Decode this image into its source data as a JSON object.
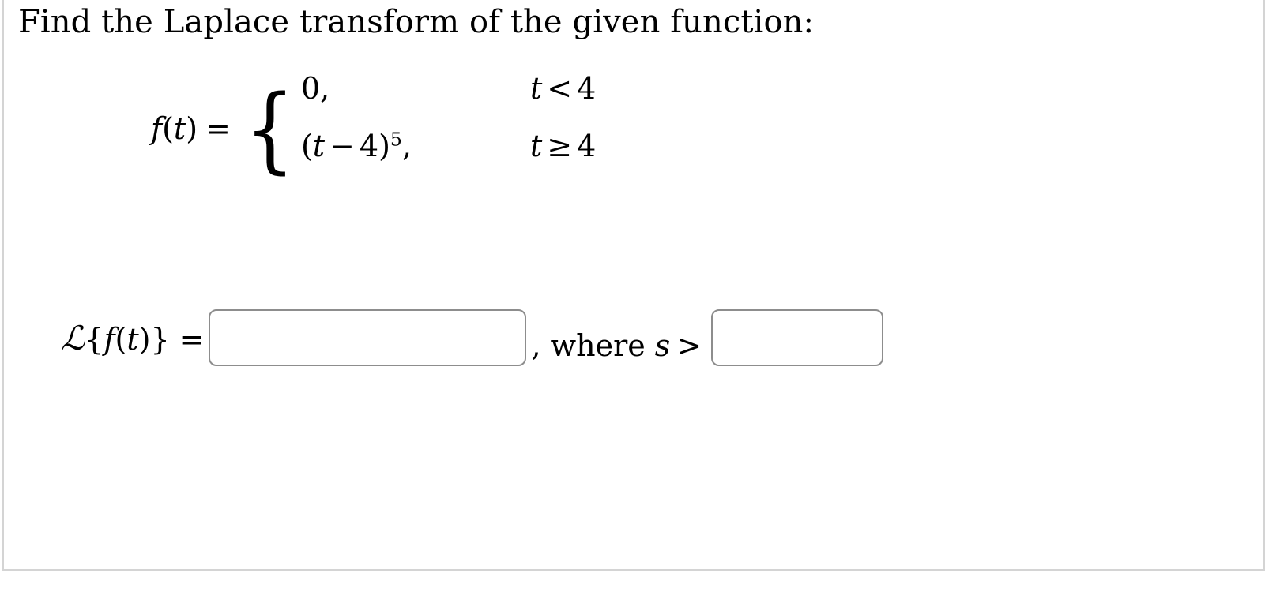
{
  "question": {
    "prompt": "Find the Laplace transform of the given function:",
    "function_definition": {
      "name": "f",
      "variable": "t",
      "label_open_paren": "(",
      "label_close_paren": ")",
      "equals": "=",
      "brace": "{",
      "cases": [
        {
          "expression": "0,",
          "expr_value": "0",
          "expr_comma": ",",
          "condition_var": "t",
          "condition_relation": "<",
          "condition_value": "4"
        },
        {
          "expression": "(t − 4)^5,",
          "expr_open_paren": "(",
          "expr_base_var": "t",
          "expr_operator": "−",
          "expr_shift": "4",
          "expr_close_paren": ")",
          "expr_exponent": "5",
          "expr_comma": ",",
          "condition_var": "t",
          "condition_relation": "≥",
          "condition_value": "4"
        }
      ]
    },
    "answer": {
      "laplace_script": "ℒ",
      "open_brace": "{",
      "fn_name": "f",
      "open_paren": "(",
      "fn_variable": "t",
      "close_paren": ")",
      "close_brace": "}",
      "equals": "=",
      "transform_value": "",
      "transform_placeholder": "",
      "separator_comma": ",",
      "where_text": "where",
      "where_variable": "s",
      "where_relation": ">",
      "bound_value": "",
      "bound_placeholder": ""
    }
  },
  "style": {
    "card_border_color": "#d4d4d4",
    "input_border_color": "#8d8d8d",
    "text_color": "#000000",
    "background_color": "#ffffff"
  }
}
